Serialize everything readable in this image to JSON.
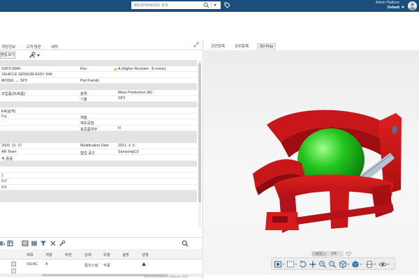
{
  "header": {
    "search": {
      "placeholder": "3DEXPERIENCE 검색"
    },
    "user": {
      "name": "Admin Platform",
      "role": "Default"
    },
    "colors": {
      "bar": "#1b4e7d"
    }
  },
  "left_panel": {
    "tabs": [
      "개정정보",
      "고객 평판",
      "세력"
    ],
    "toolbar": {
      "view_button": "편집 보기"
    },
    "rows": [
      {
        "type": "section"
      },
      {
        "type": "data",
        "c1": "SSP3-0084",
        "c2": "Rev",
        "c3": "A (Higher Revision : B exists)",
        "c3_warning": true
      },
      {
        "type": "data",
        "c1": "VEHICLE SENSOR ASSY 34A",
        "c2": "",
        "c3": ""
      },
      {
        "type": "data",
        "c1": "MODEL ↔ SP3",
        "c2": "Part Family",
        "c3": ""
      },
      {
        "type": "section"
      },
      {
        "type": "data",
        "c1": "조립품(SUB품)",
        "c2": "분류",
        "c3": "Mass Production (M)"
      },
      {
        "type": "data",
        "c1": "",
        "c2": "기종",
        "c3": "SP3"
      },
      {
        "type": "section"
      },
      {
        "type": "data",
        "c1": "EA(낱개)",
        "c2": "",
        "c3": ""
      },
      {
        "type": "data",
        "c1": "0 g",
        "c2": "재질",
        "c3": ""
      },
      {
        "type": "data",
        "c1": "",
        "c2": "제조공법",
        "c3": ""
      },
      {
        "type": "data",
        "c1": "",
        "c2": "표준품여부",
        "c3": "N"
      },
      {
        "type": "section"
      },
      {
        "type": "section"
      },
      {
        "type": "data",
        "c1": "2020. 12. 17",
        "c2": "Modification Date",
        "c3": "2021. 3. 9."
      },
      {
        "type": "data",
        "c1": "AR Team",
        "c2": "협업 공간",
        "c3": "SamsongCS"
      },
      {
        "type": "data",
        "c1": "작 중음",
        "c2": "",
        "c3": ""
      },
      {
        "type": "section"
      },
      {
        "type": "data",
        "c1": "",
        "c2": "",
        "c3": ""
      },
      {
        "type": "data",
        "c1": "1",
        "c2": "",
        "c3": ""
      },
      {
        "type": "data",
        "c1": "0.0",
        "c2": "",
        "c3": ""
      },
      {
        "type": "data",
        "c1": "0.0",
        "c2": "",
        "c3": ""
      },
      {
        "type": "section"
      },
      {
        "type": "section"
      }
    ],
    "grid": {
      "columns": [
        "제목",
        "개정",
        "버전",
        "상태",
        "유형",
        "설명",
        "성명"
      ],
      "rows": [
        {
          "title": "VEHIC",
          "rev": "A",
          "version": "",
          "state": "릴리스됨",
          "type": "부품",
          "desc": "",
          "owner": ""
        }
      ]
    }
  },
  "right_panel": {
    "tabs": [
      "관련항목",
      "상위항목",
      "3D Play"
    ],
    "active_tab": "3D Play",
    "mode_toggle": [
      "보기",
      "검토"
    ],
    "colors": {
      "part_red": "#c8161a",
      "sphere_green": "#22c61e"
    }
  },
  "footer": {
    "text": "3DEXPERIENCE Platform 정보"
  }
}
